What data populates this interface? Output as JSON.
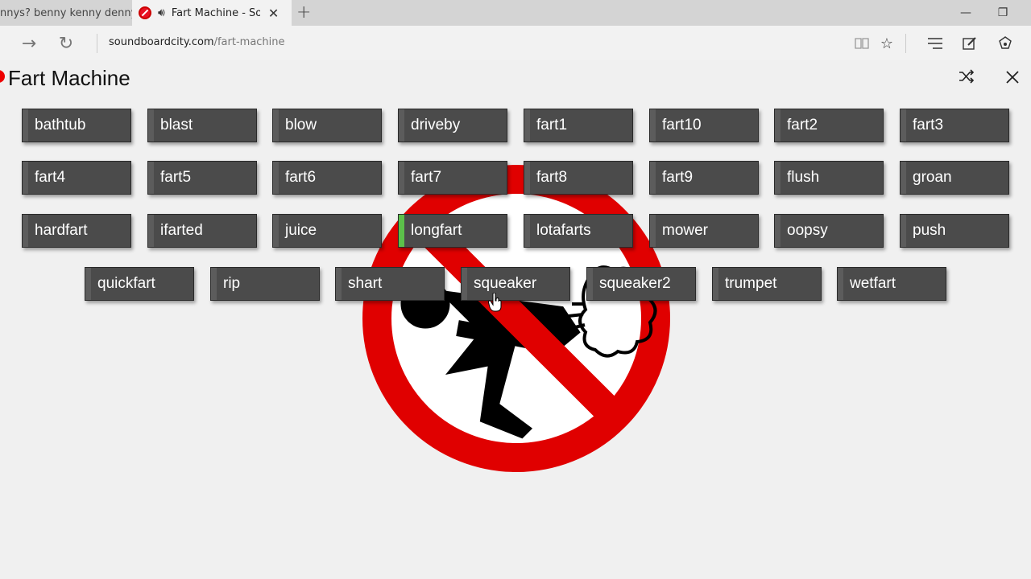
{
  "browser": {
    "tabs": [
      {
        "title": "ennys? benny kenny denny",
        "active": false
      },
      {
        "title": "Fart Machine - Soundboard",
        "active": true
      }
    ],
    "url_domain": "soundboardcity.com",
    "url_path": "/fart-machine"
  },
  "page": {
    "title": "Fart Machine",
    "buttons": [
      "bathtub",
      "blast",
      "blow",
      "driveby",
      "fart1",
      "fart10",
      "fart2",
      "fart3",
      "fart4",
      "fart5",
      "fart6",
      "fart7",
      "fart8",
      "fart9",
      "flush",
      "groan",
      "hardfart",
      "ifarted",
      "juice",
      "longfart",
      "lotafarts",
      "mower",
      "oopsy",
      "push",
      "quickfart",
      "rip",
      "shart",
      "squeaker",
      "squeaker2",
      "trumpet",
      "wetfart"
    ],
    "playing_button": "longfart",
    "accent_color": "#5cc04a",
    "sign_color": "#e00000"
  }
}
